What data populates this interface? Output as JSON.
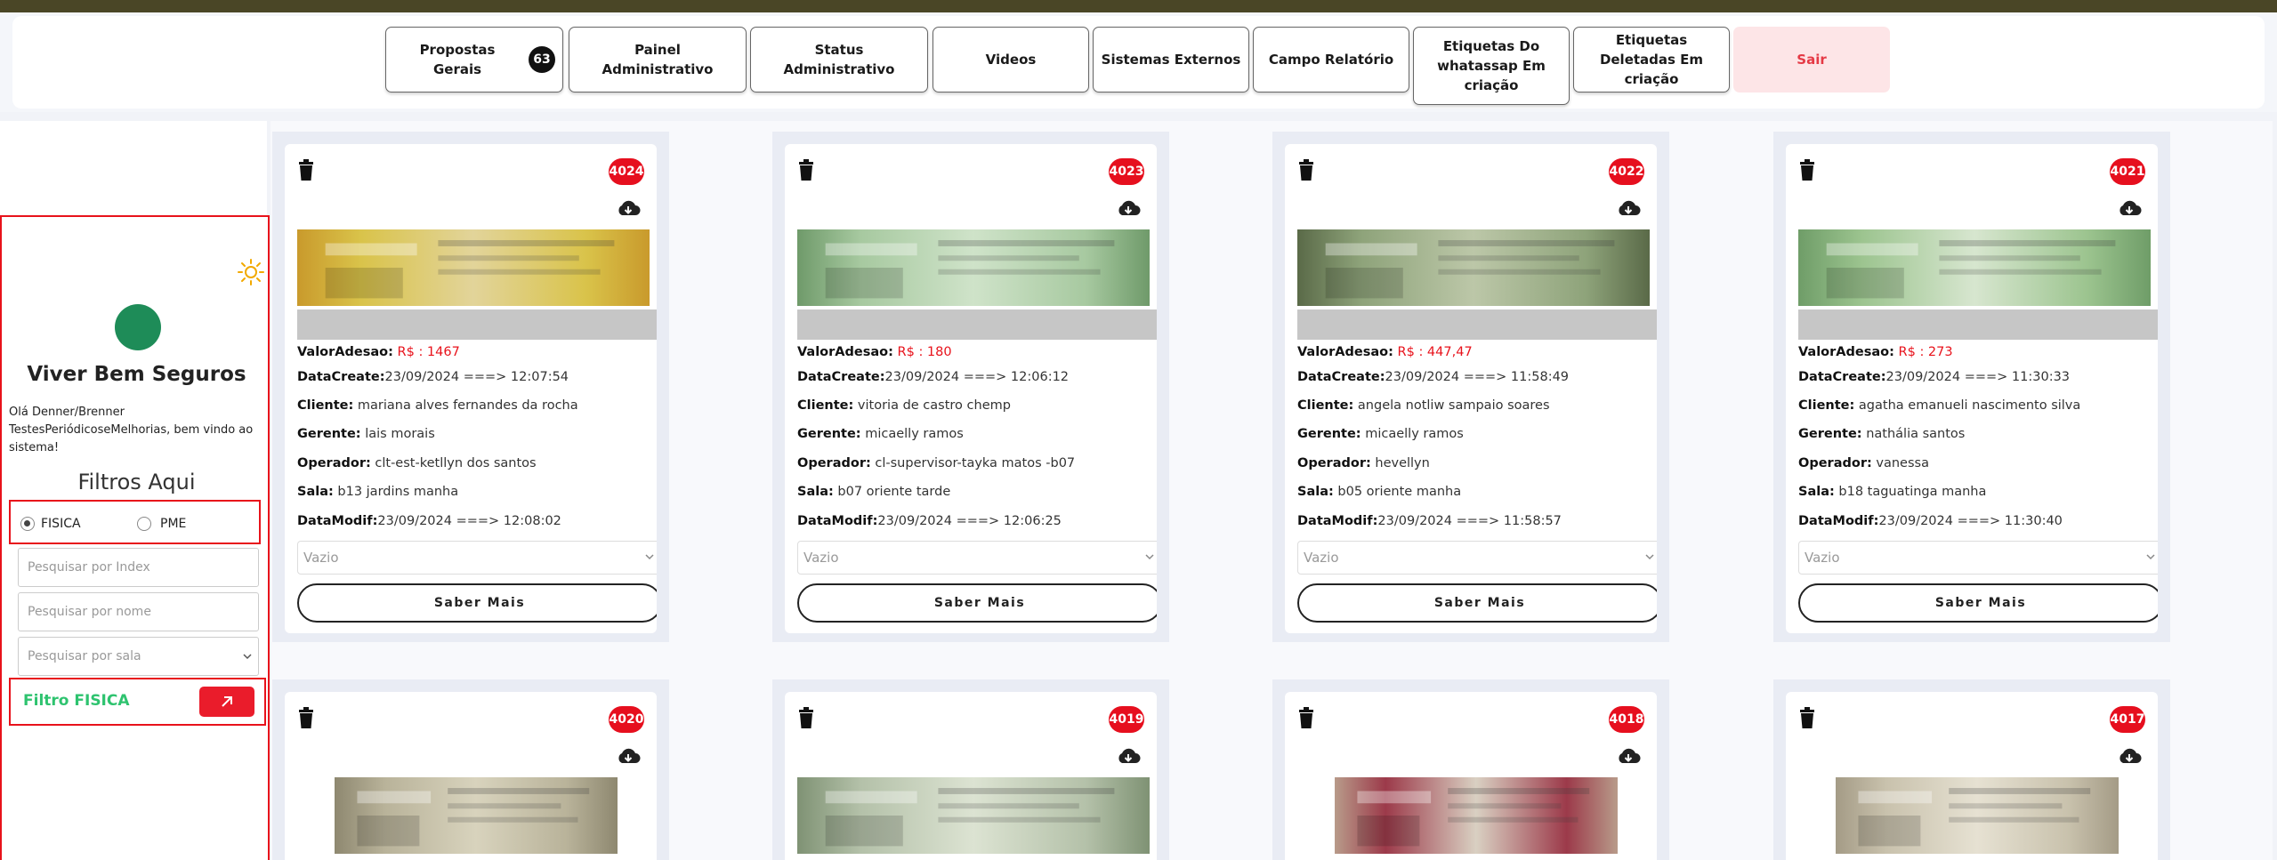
{
  "nav": {
    "items": [
      {
        "label": "Propostas Gerais",
        "badge": "63"
      },
      {
        "label": "Painel Administrativo"
      },
      {
        "label": "Status Administrativo"
      },
      {
        "label": "Videos"
      },
      {
        "label": "Sistemas Externos"
      },
      {
        "label": "Campo Relatório"
      },
      {
        "label": "Etiquetas Do whatassap Em criação"
      },
      {
        "label": "Etiquetas Deletadas Em criação"
      },
      {
        "label": "Sair"
      }
    ]
  },
  "sidebar": {
    "brand": "Viver Bem Seguros",
    "welcome": "Olá Denner/Brenner TestesPeriódicoseMelhorias, bem vindo ao sistema!",
    "filters_title": "Filtros Aqui",
    "radio_fisica": "FISICA",
    "radio_pme": "PME",
    "selected_type": "FISICA",
    "index_placeholder": "Pesquisar por Index",
    "name_placeholder": "Pesquisar por nome",
    "sala_placeholder": "Pesquisar por sala",
    "filter_label": "Filtro FISICA"
  },
  "labels": {
    "valor": "ValorAdesao:",
    "datacreate": "DataCreate:",
    "cliente": "Cliente:",
    "gerente": "Gerente:",
    "operador": "Operador:",
    "sala": "Sala:",
    "datamodif": "DataModif:",
    "select_value": "Vazio",
    "saber_mais": "Saber Mais"
  },
  "cards": [
    {
      "id": "4024",
      "valor": "R$ :  1467",
      "datacreate": "23/09/2024  ===> 12:07:54",
      "cliente": "mariana alves fernandes da rocha",
      "gerente": "lais morais",
      "operador": "clt-est-ketllyn  dos santos",
      "sala": "b13 jardins manha",
      "datamodif": "23/09/2024  ===> 12:08:02"
    },
    {
      "id": "4023",
      "valor": "R$ :  180",
      "datacreate": "23/09/2024  ===> 12:06:12",
      "cliente": "vitoria de castro chemp",
      "gerente": "micaelly ramos",
      "operador": "cl-supervisor-tayka matos -b07",
      "sala": "b07 oriente tarde",
      "datamodif": "23/09/2024  ===> 12:06:25"
    },
    {
      "id": "4022",
      "valor": "R$ :  447,47",
      "datacreate": "23/09/2024  ===> 11:58:49",
      "cliente": "angela notliw sampaio soares",
      "gerente": "micaelly ramos",
      "operador": "hevellyn",
      "sala": "b05 oriente manha",
      "datamodif": "23/09/2024  ===> 11:58:57"
    },
    {
      "id": "4021",
      "valor": "R$ :  273",
      "datacreate": "23/09/2024  ===> 11:30:33",
      "cliente": "agatha emanueli nascimento silva",
      "gerente": "nathália santos",
      "operador": "vanessa",
      "sala": "b18 taguatinga manha",
      "datamodif": "23/09/2024  ===> 11:30:40"
    },
    {
      "id": "4020"
    },
    {
      "id": "4019"
    },
    {
      "id": "4018"
    },
    {
      "id": "4017"
    }
  ],
  "colors": {
    "accent_red": "#e8121b",
    "badge_red": "#e60f1e",
    "filter_green": "#2ec36f",
    "avatar_green": "#1e8c58",
    "sair_bg": "#fde5e7"
  },
  "icons": [
    "trash-icon",
    "cloud-download-icon",
    "sun-icon",
    "arrow-up-right-icon",
    "chevron-down-icon"
  ]
}
